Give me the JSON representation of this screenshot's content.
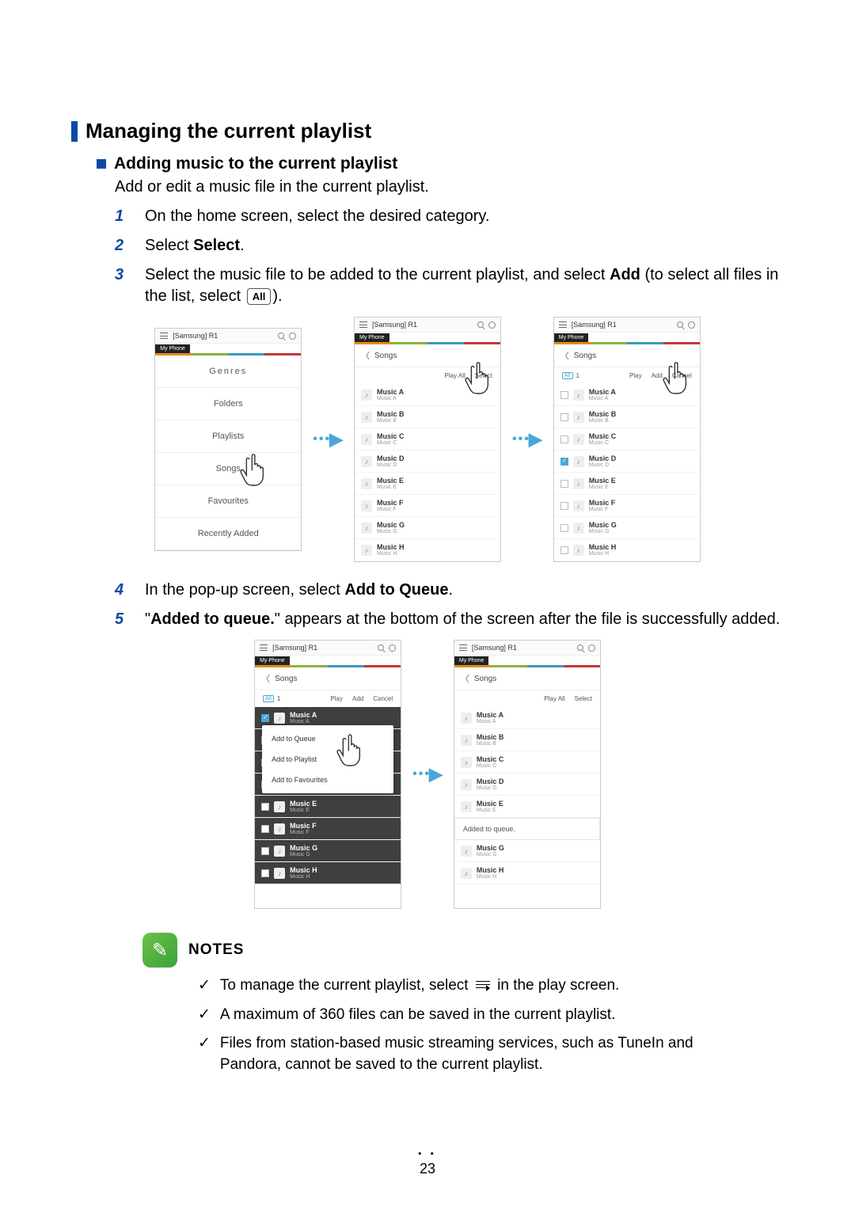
{
  "h1": "Managing the current playlist",
  "h2": "Adding music to the current playlist",
  "intro": "Add or edit a music file in the current playlist.",
  "steps": {
    "s1": "On the home screen, select the desired category.",
    "s2_a": "Select ",
    "s2_b": "Select",
    "s2_c": ".",
    "s3_a": "Select the music file to be added to the current playlist, and select ",
    "s3_b": "Add",
    "s3_c": " (to select all files in the list, select ",
    "s3_all": "All",
    "s3_d": ").",
    "s4_a": "In the pop-up screen, select ",
    "s4_b": "Add to Queue",
    "s4_c": ".",
    "s5_a": "\"",
    "s5_b": "Added to queue.",
    "s5_c": "\" appears at the bottom of the screen after the file is successfully added."
  },
  "device_title": "[Samsung] R1",
  "tab_label": "My Phone",
  "crumb_songs": "Songs",
  "categories_ghost": "Genres",
  "categories": [
    "Folders",
    "Playlists",
    "Songs",
    "Favourites",
    "Recently Added"
  ],
  "actions": {
    "playall": "Play All",
    "select": "Select",
    "play": "Play",
    "add": "Add",
    "cancel": "Cancel",
    "all": "All",
    "one": "1"
  },
  "songs": [
    {
      "t": "Music A",
      "s": "Music A"
    },
    {
      "t": "Music B",
      "s": "Music B"
    },
    {
      "t": "Music C",
      "s": "Music C"
    },
    {
      "t": "Music D",
      "s": "Music D"
    },
    {
      "t": "Music E",
      "s": "Music E"
    },
    {
      "t": "Music F",
      "s": "Music F"
    },
    {
      "t": "Music G",
      "s": "Music G"
    },
    {
      "t": "Music H",
      "s": "Music H"
    }
  ],
  "songs_short": [
    {
      "t": "Music A",
      "s": "Music A"
    },
    {
      "t": "Music B",
      "s": "Music B"
    },
    {
      "t": "Music C",
      "s": "Music C"
    },
    {
      "t": "Music D",
      "s": "Music D"
    },
    {
      "t": "Music E",
      "s": "Music E"
    }
  ],
  "popup": {
    "queue": "Add to Queue",
    "playlist": "Add to Playlist",
    "fav": "Add to Favourites"
  },
  "toast": "Added to queue.",
  "notes_title": "NOTES",
  "notes": {
    "n1_a": "To manage the current playlist, select ",
    "n1_b": " in the play screen.",
    "n2": "A maximum of 360 files can be saved in the current playlist.",
    "n3": "Files from station-based music streaming services, such as TuneIn and Pandora, cannot be saved to the current playlist."
  },
  "page_number": "23",
  "page_dots": "• •"
}
